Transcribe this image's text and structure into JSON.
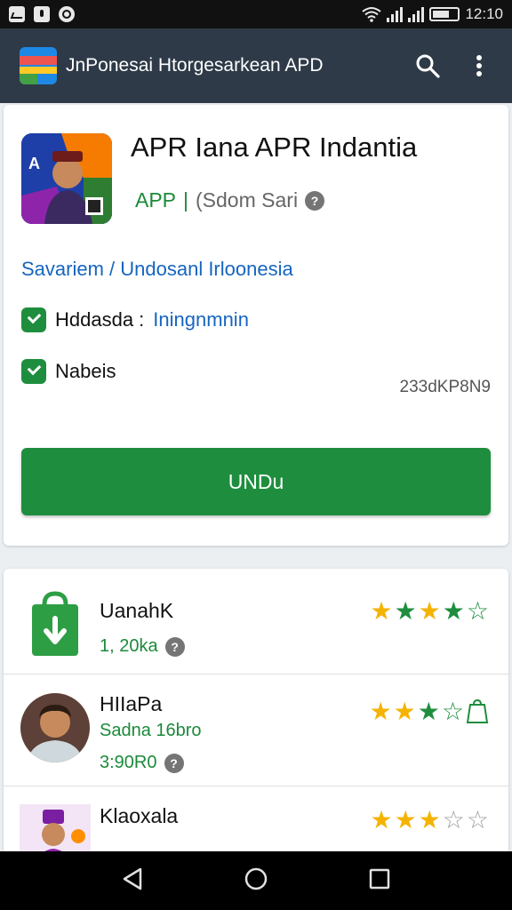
{
  "status_bar": {
    "time": "12:10"
  },
  "app_bar": {
    "title": "JnPonesai  Htorgesarkean  APD",
    "search_icon": "search-icon",
    "more_icon": "more-vert-icon"
  },
  "hero": {
    "title": "APR Iana APR Indantia",
    "tag": "APP",
    "separator": "|",
    "developer": "(Sdom Sari",
    "category_link": "Savariem / Undosanl Irloonesia",
    "feature_1_label": "Hddasda :",
    "feature_1_value": "Iningnmnin",
    "feature_2_label": "Nabeis",
    "download_count": "233dKP8N9",
    "install_label": "UNDu"
  },
  "list": [
    {
      "name": "UanahK",
      "meta": "1, 20ka",
      "rating": 4.5,
      "star_colors": [
        "#f5b301",
        "#1e8e3e",
        "#f5b301",
        "#1e8e3e"
      ]
    },
    {
      "name": "HIIaPa",
      "developer": "Sadna 16bro",
      "meta": "3:90R0",
      "rating": 2.5,
      "star_colors": [
        "#f5b301",
        "#f5b301"
      ]
    },
    {
      "name": "Klaoxala",
      "rating": 3,
      "star_colors": [
        "#f5b301",
        "#f5b301",
        "#f5b301"
      ]
    }
  ],
  "colors": {
    "accent_green": "#1e8e3e",
    "app_bar": "#2e3a48",
    "link_blue": "#1565c0",
    "star_gold": "#f5b301"
  }
}
